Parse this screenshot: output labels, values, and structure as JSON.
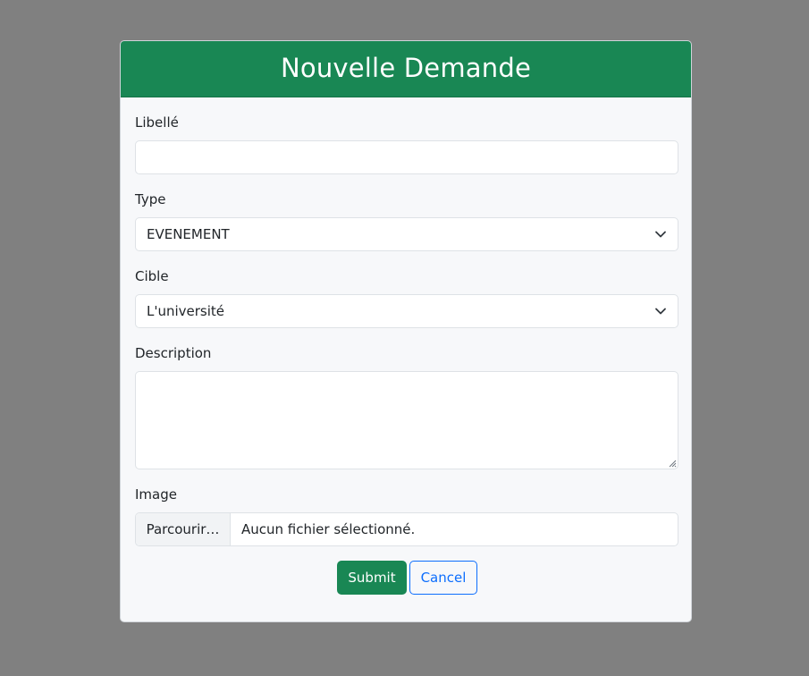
{
  "modal": {
    "title": "Nouvelle Demande"
  },
  "form": {
    "libelle": {
      "label": "Libellé",
      "value": ""
    },
    "type": {
      "label": "Type",
      "selected": "EVENEMENT"
    },
    "cible": {
      "label": "Cible",
      "selected": "L'université"
    },
    "description": {
      "label": "Description",
      "value": ""
    },
    "image": {
      "label": "Image",
      "browse_label": "Parcourir…",
      "file_status": "Aucun fichier sélectionné."
    }
  },
  "actions": {
    "submit_label": "Submit",
    "cancel_label": "Cancel"
  },
  "colors": {
    "header_bg": "#198754",
    "submit_bg": "#198754",
    "cancel_accent": "#0d6efd",
    "backdrop": "#808080",
    "modal_bg": "#f7f8fa"
  },
  "icons": {
    "select_chevron": "chevron-down-icon",
    "textarea_resize": "resize-grip-icon"
  }
}
